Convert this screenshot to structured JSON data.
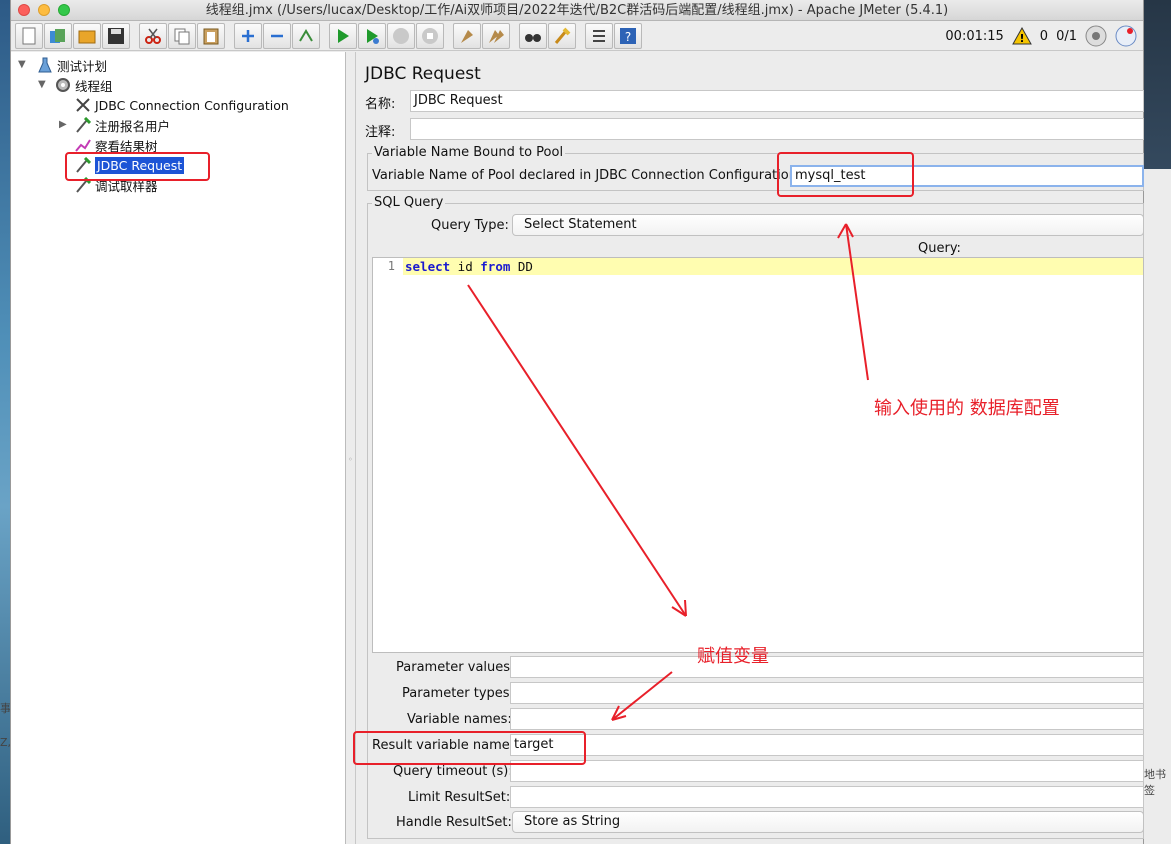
{
  "window": {
    "title": "线程组.jmx (/Users/lucax/Desktop/工作/Ai双师项目/2022年迭代/B2C群活码后端配置/线程组.jmx) - Apache JMeter (5.4.1)"
  },
  "toolbar": {
    "buttons": [
      "new-icon",
      "templates-icon",
      "open-icon",
      "save-icon",
      "cut-icon",
      "copy-icon",
      "paste-icon",
      "expand-icon",
      "collapse-icon",
      "toggle-icon",
      "start-icon",
      "start-no-timers-icon",
      "stop-icon",
      "shutdown-icon",
      "clear-icon",
      "clear-all-icon",
      "search-icon",
      "reset-search-icon",
      "function-helper-icon",
      "help-icon"
    ],
    "timer": "00:01:15",
    "warnings": "0",
    "threads": "0/1"
  },
  "tree": {
    "items": [
      {
        "label": "测试计划",
        "icon": "test-plan-icon"
      },
      {
        "label": "线程组",
        "icon": "thread-group-icon"
      },
      {
        "label": "JDBC Connection Configuration",
        "icon": "config-icon"
      },
      {
        "label": "注册报名用户",
        "icon": "sampler-icon"
      },
      {
        "label": "察看结果树",
        "icon": "listener-icon"
      },
      {
        "label": "JDBC Request",
        "icon": "sampler-icon"
      },
      {
        "label": "调试取样器",
        "icon": "sampler-icon"
      }
    ]
  },
  "form": {
    "title": "JDBC Request",
    "name_label": "名称:",
    "name_value": "JDBC Request",
    "comment_label": "注释:",
    "comment_value": "",
    "pool_legend": "Variable Name Bound to Pool",
    "pool_label": "Variable Name of Pool declared in JDBC Connection Configuration:",
    "pool_value": "mysql_test",
    "sql_legend": "SQL Query",
    "query_type_label": "Query Type:",
    "query_type_value": "Select Statement",
    "query_label": "Query:",
    "code": {
      "line_number": "1",
      "kw_select": "select",
      "text_id": " id ",
      "kw_from": "from",
      "text_table": " DD"
    },
    "param_values_label": "Parameter values:",
    "param_types_label": "Parameter types:",
    "variable_names_label": "Variable names:",
    "result_var_label": "Result variable name:",
    "result_var_value": "target",
    "query_timeout_label": "Query timeout (s):",
    "limit_resultset_label": "Limit ResultSet:",
    "handle_resultset_label": "Handle ResultSet:",
    "handle_resultset_value": "Store as String"
  },
  "annotations": {
    "db_config_note": "输入使用的 数据库配置",
    "assign_var_note": "赋值变量",
    "color": "#e8202a"
  },
  "desktop": {
    "frag1": "事",
    "frag2": "Z,",
    "frag3": "地书签"
  }
}
